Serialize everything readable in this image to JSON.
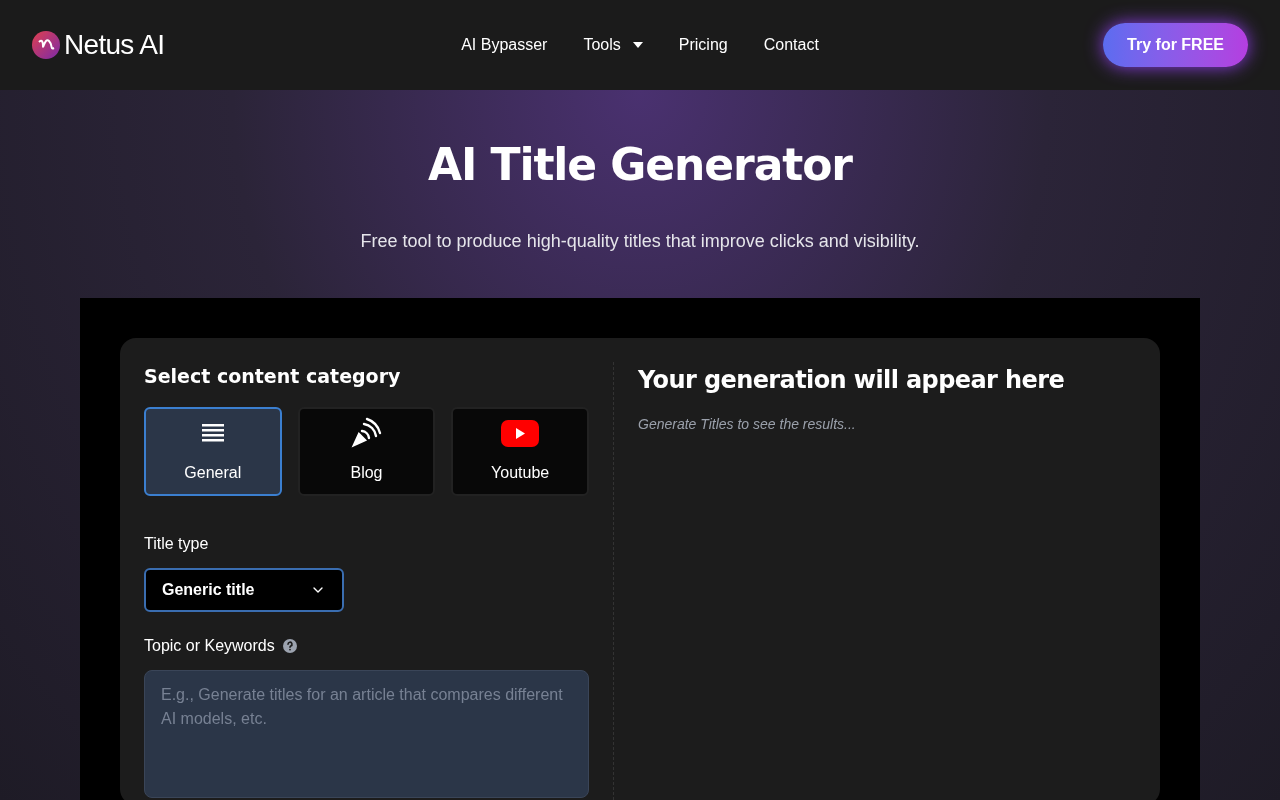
{
  "header": {
    "logo": "Netus AI",
    "nav": [
      {
        "label": "AI Bypasser",
        "kind": "link"
      },
      {
        "label": "Tools",
        "kind": "dropdown"
      },
      {
        "label": "Pricing",
        "kind": "link"
      },
      {
        "label": "Contact",
        "kind": "link"
      }
    ],
    "cta": "Try for FREE"
  },
  "hero": {
    "title": "AI Title Generator",
    "subtitle": "Free tool to produce high-quality titles that improve clicks and visibility."
  },
  "form": {
    "category_heading": "Select content category",
    "categories": [
      {
        "label": "General",
        "kind": "general",
        "selected": true
      },
      {
        "label": "Blog",
        "kind": "blog",
        "selected": false
      },
      {
        "label": "Youtube",
        "kind": "youtube",
        "selected": false
      }
    ],
    "title_type_label": "Title type",
    "title_type_value": "Generic title",
    "topic_label": "Topic or Keywords",
    "topic_placeholder": "E.g., Generate titles for an article that compares different AI models, etc."
  },
  "output": {
    "heading": "Your generation will appear here",
    "hint": "Generate Titles to see the results..."
  }
}
